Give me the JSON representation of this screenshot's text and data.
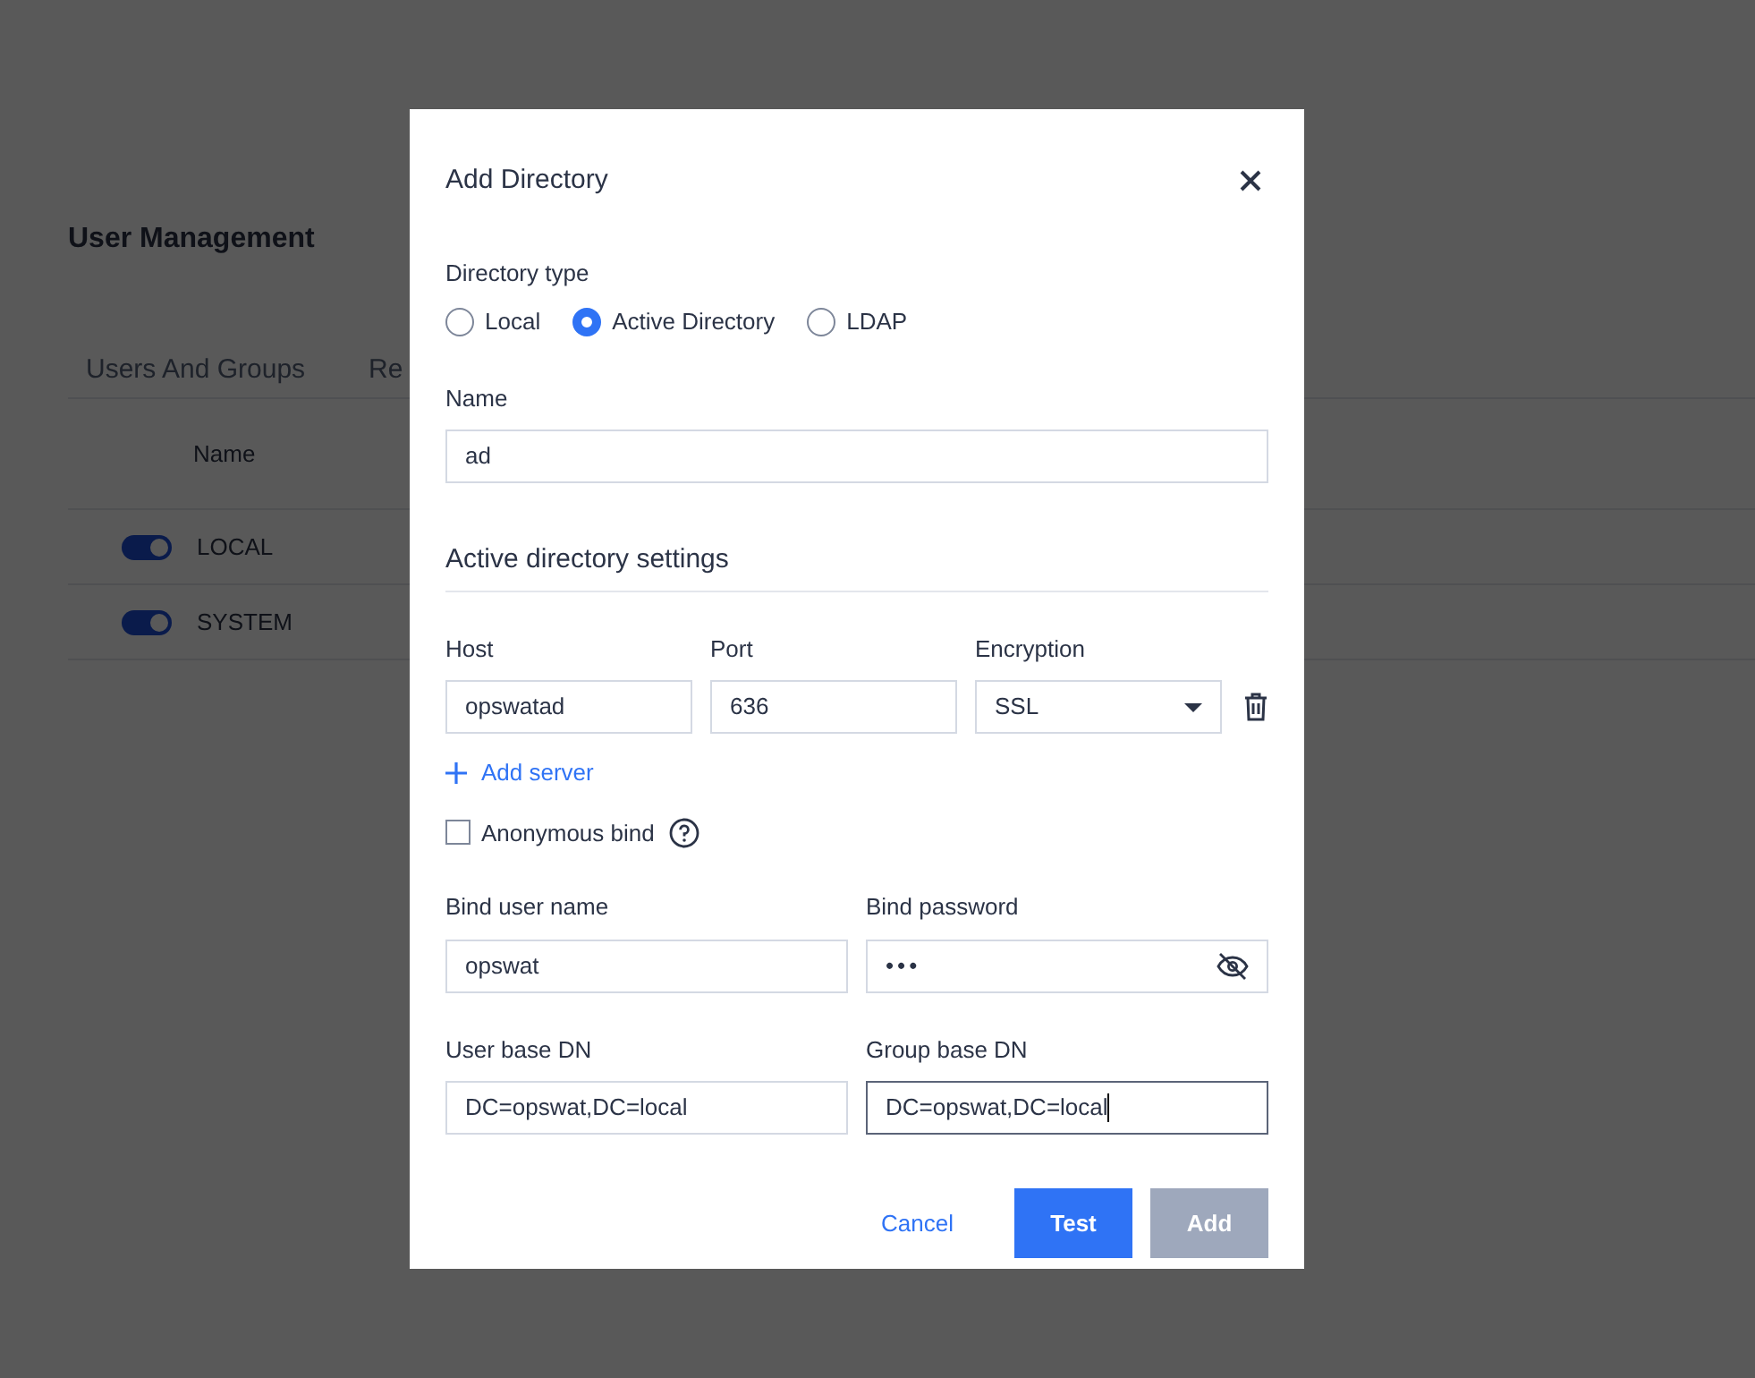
{
  "page": {
    "title": "User Management",
    "tabs": [
      "Users And Groups",
      "Re"
    ],
    "table": {
      "columns": [
        "Name"
      ],
      "rows": [
        {
          "name": "LOCAL",
          "enabled": true
        },
        {
          "name": "SYSTEM",
          "enabled": true
        }
      ]
    }
  },
  "dialog": {
    "title": "Add Directory",
    "directory_type": {
      "label": "Directory type",
      "options": [
        {
          "label": "Local",
          "selected": false
        },
        {
          "label": "Active Directory",
          "selected": true
        },
        {
          "label": "LDAP",
          "selected": false
        }
      ]
    },
    "name": {
      "label": "Name",
      "value": "ad"
    },
    "section_title": "Active directory settings",
    "server_columns": [
      "Host",
      "Port",
      "Encryption"
    ],
    "servers": [
      {
        "host": "opswatad",
        "port": "636",
        "encryption": "SSL"
      }
    ],
    "add_server": "Add server",
    "anonymous_bind": {
      "label": "Anonymous bind",
      "checked": false
    },
    "bind_user": {
      "label": "Bind user name",
      "value": "opswat"
    },
    "bind_password": {
      "label": "Bind password",
      "value": "•••"
    },
    "user_base_dn": {
      "label": "User base DN",
      "value": "DC=opswat,DC=local",
      "focused": false
    },
    "group_base_dn": {
      "label": "Group base DN",
      "value": "DC=opswat,DC=local",
      "focused": true
    },
    "buttons": [
      {
        "label": "Cancel",
        "kind": "link",
        "disabled": false
      },
      {
        "label": "Test",
        "kind": "primary",
        "disabled": false
      },
      {
        "label": "Add",
        "kind": "primary",
        "disabled": true
      }
    ]
  }
}
